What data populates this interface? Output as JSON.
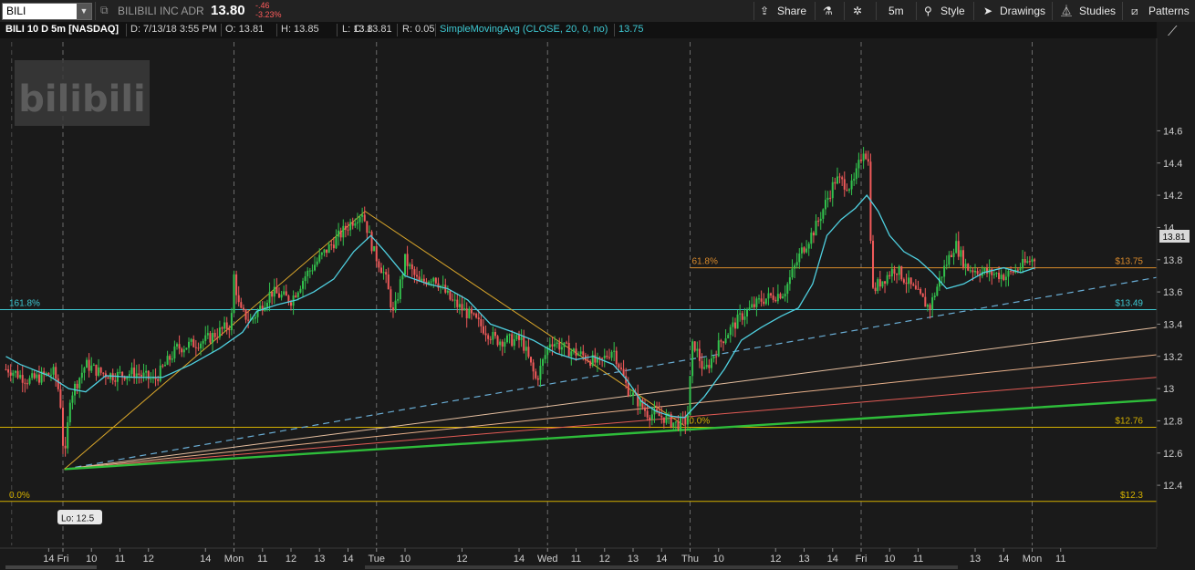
{
  "toolbar": {
    "symbol": "BILI",
    "company": "BILIBILI INC ADR",
    "last": "13.80",
    "change": "-.46",
    "change_pct": "-3.23%",
    "share": "Share",
    "interval": "5m",
    "style": "Style",
    "drawings": "Drawings",
    "studies": "Studies",
    "patterns": "Patterns"
  },
  "header": {
    "title": "BILI 10 D 5m [NASDAQ]",
    "date": "D: 7/13/18 3:55 PM",
    "open": "O: 13.81",
    "high": "H: 13.85",
    "low": "L: 13.8",
    "close": "C: 13.81",
    "range": "R: 0.05",
    "study": "SimpleMovingAvg (CLOSE, 20, 0, no)",
    "study_value": "13.75"
  },
  "chart_data": {
    "type": "candlestick",
    "y_axis": {
      "min": 12.3,
      "max": 14.7,
      "ticks": [
        "12.4",
        "12.6",
        "12.8",
        "13",
        "13.2",
        "13.4",
        "13.6",
        "13.8",
        "14",
        "14.2",
        "14.4",
        "14.6"
      ]
    },
    "x_ticks": [
      "14",
      "Fri",
      "10",
      "11",
      "12",
      "14",
      "Mon",
      "11",
      "12",
      "13",
      "14",
      "Tue",
      "10",
      "12",
      "14",
      "Wed",
      "11",
      "12",
      "13",
      "14",
      "Thu",
      "10",
      "12",
      "13",
      "14",
      "Fri",
      "10",
      "11",
      "13",
      "14",
      "Mon",
      "11"
    ],
    "x_tick_times": [
      -0.5,
      0,
      1,
      2,
      3,
      5,
      6,
      7,
      8,
      9,
      10,
      11,
      12,
      14,
      16,
      17,
      18,
      19,
      20,
      21,
      22,
      23,
      25,
      26,
      27,
      28,
      29,
      30,
      32,
      33,
      34,
      35
    ],
    "price_path": [
      [
        -1.9,
        13.12
      ],
      [
        -1.2,
        13.05
      ],
      [
        -0.3,
        13.1
      ],
      [
        -0.1,
        12.95
      ],
      [
        0.05,
        12.52
      ],
      [
        0.25,
        12.95
      ],
      [
        0.8,
        13.15
      ],
      [
        1.3,
        13.1
      ],
      [
        1.8,
        13.08
      ],
      [
        2.5,
        13.1
      ],
      [
        3.2,
        13.05
      ],
      [
        4,
        13.25
      ],
      [
        5,
        13.3
      ],
      [
        5.9,
        13.4
      ],
      [
        6,
        13.7
      ],
      [
        6.2,
        13.48
      ],
      [
        6.6,
        13.42
      ],
      [
        7.3,
        13.6
      ],
      [
        8,
        13.55
      ],
      [
        8.5,
        13.7
      ],
      [
        9.2,
        13.85
      ],
      [
        10.2,
        14.05
      ],
      [
        10.5,
        14.1
      ],
      [
        10.9,
        13.85
      ],
      [
        11.3,
        13.7
      ],
      [
        11.6,
        13.45
      ],
      [
        12,
        13.8
      ],
      [
        12.5,
        13.65
      ],
      [
        13,
        13.7
      ],
      [
        13.6,
        13.55
      ],
      [
        14.3,
        13.45
      ],
      [
        15.2,
        13.3
      ],
      [
        16.1,
        13.3
      ],
      [
        16.6,
        13.05
      ],
      [
        17.1,
        13.3
      ],
      [
        17.6,
        13.25
      ],
      [
        18.3,
        13.2
      ],
      [
        18.8,
        13.15
      ],
      [
        19.3,
        13.25
      ],
      [
        19.8,
        13
      ],
      [
        20.5,
        12.85
      ],
      [
        21.1,
        12.82
      ],
      [
        21.5,
        12.78
      ],
      [
        21.9,
        12.8
      ],
      [
        22.1,
        13.3
      ],
      [
        22.5,
        13.1
      ],
      [
        23.1,
        13.3
      ],
      [
        23.8,
        13.45
      ],
      [
        24.5,
        13.55
      ],
      [
        25.3,
        13.6
      ],
      [
        25.9,
        13.85
      ],
      [
        26.4,
        14.0
      ],
      [
        27.1,
        14.3
      ],
      [
        27.7,
        14.25
      ],
      [
        28.1,
        14.5
      ],
      [
        28.25,
        14.4
      ],
      [
        28.4,
        13.6
      ],
      [
        28.6,
        13.65
      ],
      [
        29.2,
        13.75
      ],
      [
        29.9,
        13.6
      ],
      [
        30.4,
        13.5
      ],
      [
        30.8,
        13.7
      ],
      [
        31.3,
        13.9
      ],
      [
        31.7,
        13.75
      ],
      [
        32.4,
        13.72
      ],
      [
        33.1,
        13.7
      ],
      [
        33.8,
        13.78
      ],
      [
        34.1,
        13.81
      ]
    ],
    "sma_path": [
      [
        -2,
        13.2
      ],
      [
        -1.5,
        13.15
      ],
      [
        -0.5,
        13.08
      ],
      [
        0.2,
        13.0
      ],
      [
        0.8,
        12.98
      ],
      [
        1.5,
        13.08
      ],
      [
        2.5,
        13.07
      ],
      [
        3.5,
        13.07
      ],
      [
        4.5,
        13.15
      ],
      [
        5.5,
        13.25
      ],
      [
        6.3,
        13.35
      ],
      [
        6.8,
        13.48
      ],
      [
        7.5,
        13.52
      ],
      [
        8.2,
        13.55
      ],
      [
        8.8,
        13.6
      ],
      [
        9.5,
        13.68
      ],
      [
        10.2,
        13.85
      ],
      [
        10.8,
        13.95
      ],
      [
        11.3,
        13.85
      ],
      [
        12,
        13.7
      ],
      [
        12.8,
        13.65
      ],
      [
        13.5,
        13.62
      ],
      [
        14.2,
        13.55
      ],
      [
        15,
        13.4
      ],
      [
        15.8,
        13.35
      ],
      [
        16.5,
        13.3
      ],
      [
        17.3,
        13.22
      ],
      [
        18,
        13.18
      ],
      [
        18.6,
        13.2
      ],
      [
        19.3,
        13.15
      ],
      [
        19.8,
        13.05
      ],
      [
        20.3,
        12.92
      ],
      [
        20.8,
        12.86
      ],
      [
        21.3,
        12.83
      ],
      [
        21.8,
        12.82
      ],
      [
        22.5,
        12.95
      ],
      [
        23.2,
        13.12
      ],
      [
        23.8,
        13.3
      ],
      [
        24.5,
        13.38
      ],
      [
        25.2,
        13.45
      ],
      [
        25.8,
        13.5
      ],
      [
        26.3,
        13.65
      ],
      [
        26.8,
        13.95
      ],
      [
        27.3,
        14.05
      ],
      [
        27.8,
        14.12
      ],
      [
        28.2,
        14.2
      ],
      [
        28.6,
        14.1
      ],
      [
        29,
        13.95
      ],
      [
        29.5,
        13.85
      ],
      [
        30,
        13.8
      ],
      [
        30.5,
        13.72
      ],
      [
        31,
        13.62
      ],
      [
        31.6,
        13.65
      ],
      [
        32.3,
        13.72
      ],
      [
        33,
        13.75
      ],
      [
        33.6,
        13.72
      ],
      [
        34.1,
        13.75
      ]
    ],
    "hlines": [
      {
        "label": "161.8%",
        "price": 13.49,
        "value_label": "$13.49",
        "color": "#3ec8d2"
      },
      {
        "label": "61.8%",
        "price": 13.75,
        "value_label": "$13.75",
        "color": "#d98a2b"
      },
      {
        "label": "0.0%",
        "price": 12.76,
        "value_label": "$12.76",
        "color": "#d4b000"
      },
      {
        "label": "0.0%",
        "price": 12.3,
        "value_label": "$12.3",
        "color": "#d4b000"
      }
    ],
    "low_label": "Lo: 12.5",
    "current_price_badge": "13.81"
  }
}
